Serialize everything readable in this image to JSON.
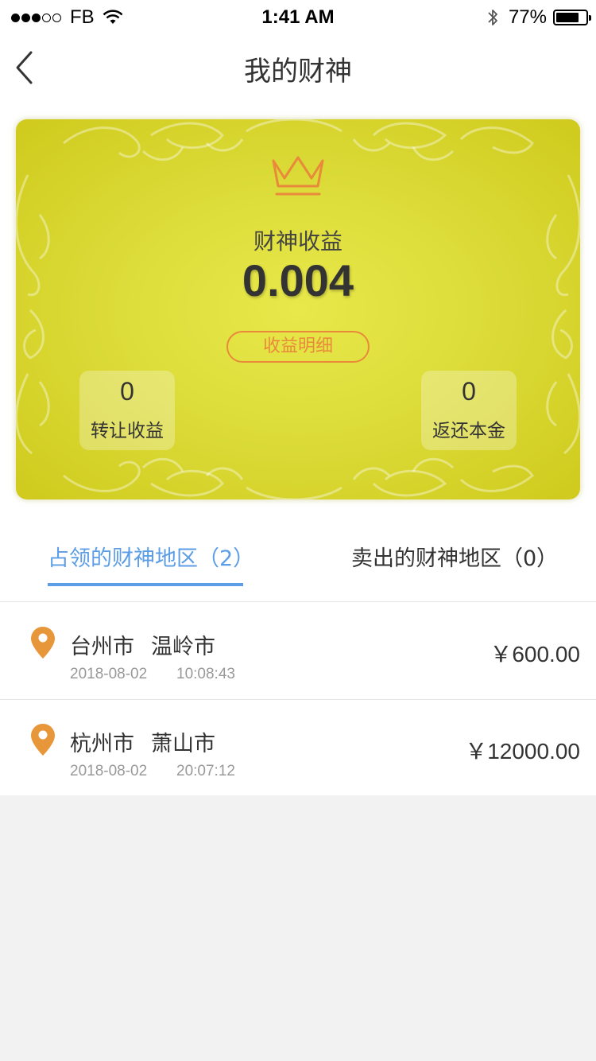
{
  "status_bar": {
    "carrier": "FB",
    "time": "1:41 AM",
    "battery_text": "77%",
    "battery_level": 0.77,
    "signal_dots_filled": 3,
    "signal_dots_total": 5
  },
  "nav": {
    "title": "我的财神",
    "back_icon": "chevron-left-icon"
  },
  "card": {
    "income_label": "财神收益",
    "income_value": "0.004",
    "detail_button_label": "收益明细",
    "transfer_income_value": "0",
    "transfer_income_label": "转让收益",
    "return_principal_value": "0",
    "return_principal_label": "返还本金",
    "accent_color": "#e88a3a"
  },
  "tabs": [
    {
      "label": "占领的财神地区（2）",
      "active": true
    },
    {
      "label": "卖出的财神地区（0）",
      "active": false
    }
  ],
  "list": [
    {
      "city": "台州市",
      "district": "温岭市",
      "date": "2018-08-02",
      "time": "10:08:43",
      "price": "￥600.00"
    },
    {
      "city": "杭州市",
      "district": "萧山市",
      "date": "2018-08-02",
      "time": "20:07:12",
      "price": "￥12000.00"
    }
  ],
  "colors": {
    "tab_active": "#5b9de6",
    "pin": "#e8963a",
    "card_gold": "#dcdc3a"
  }
}
